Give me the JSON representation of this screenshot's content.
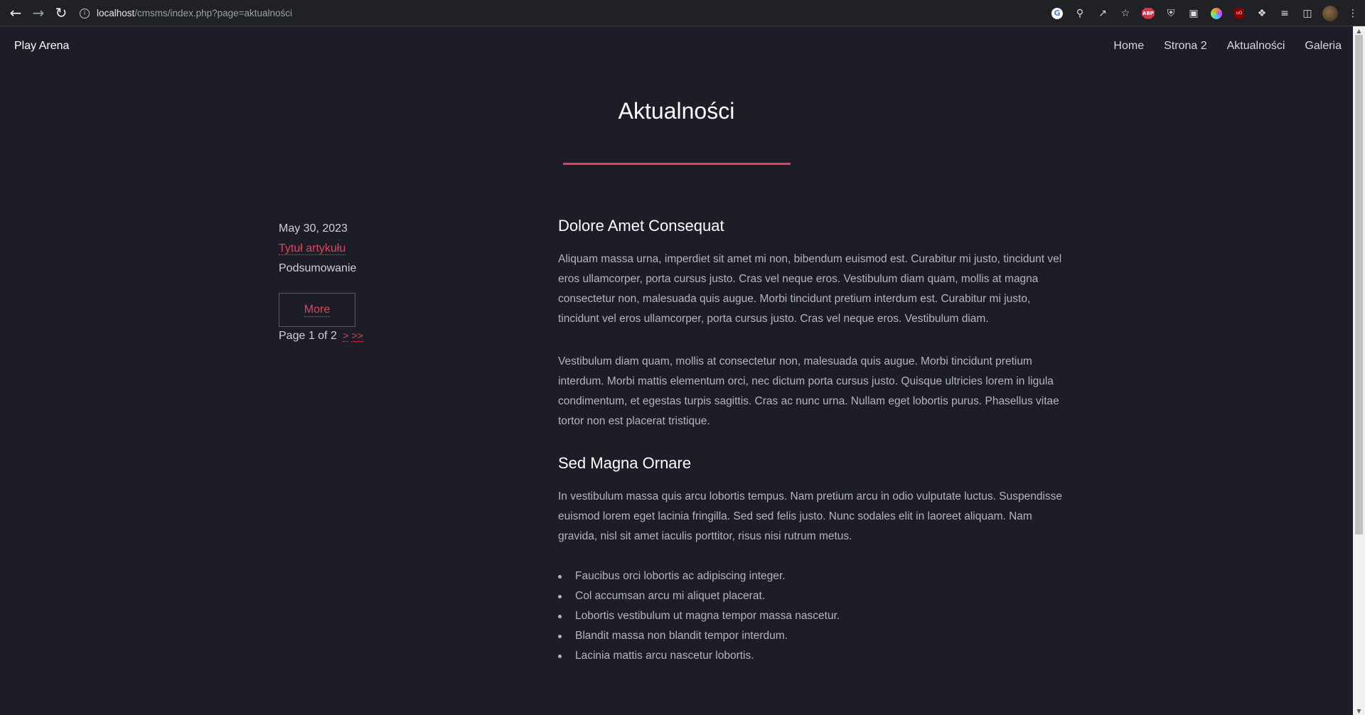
{
  "browser": {
    "url_host": "localhost",
    "url_path": "/cmsms/index.php?page=aktualności",
    "ext_abp": "ABP",
    "ext_ub": "uO"
  },
  "site": {
    "logo": "Play Arena",
    "nav": [
      "Home",
      "Strona 2",
      "Aktualności",
      "Galeria"
    ]
  },
  "page": {
    "title": "Aktualności"
  },
  "sidebar": {
    "date": "May 30, 2023",
    "article_link": "Tytuł artykułu",
    "summary": "Podsumowanie",
    "more_label": "More",
    "pager_text": "Page 1 of 2",
    "pager_next": ">",
    "pager_last": ">>"
  },
  "article": {
    "heading1": "Dolore Amet Consequat",
    "para1": "Aliquam massa urna, imperdiet sit amet mi non, bibendum euismod est. Curabitur mi justo, tincidunt vel eros ullamcorper, porta cursus justo. Cras vel neque eros. Vestibulum diam quam, mollis at magna consectetur non, malesuada quis augue. Morbi tincidunt pretium interdum est. Curabitur mi justo, tincidunt vel eros ullamcorper, porta cursus justo. Cras vel neque eros. Vestibulum diam.",
    "para2": "Vestibulum diam quam, mollis at consectetur non, malesuada quis augue. Morbi tincidunt pretium interdum. Morbi mattis elementum orci, nec dictum porta cursus justo. Quisque ultricies lorem in ligula condimentum, et egestas turpis sagittis. Cras ac nunc urna. Nullam eget lobortis purus. Phasellus vitae tortor non est placerat tristique.",
    "heading2": "Sed Magna Ornare",
    "para3": "In vestibulum massa quis arcu lobortis tempus. Nam pretium arcu in odio vulputate luctus. Suspendisse euismod lorem eget lacinia fringilla. Sed sed felis justo. Nunc sodales elit in laoreet aliquam. Nam gravida, nisl sit amet iaculis porttitor, risus nisi rutrum metus.",
    "list": [
      "Faucibus orci lobortis ac adipiscing integer.",
      "Col accumsan arcu mi aliquet placerat.",
      "Lobortis vestibulum ut magna tempor massa nascetur.",
      "Blandit massa non blandit tempor interdum.",
      "Lacinia mattis arcu nascetur lobortis."
    ]
  },
  "colors": {
    "background": "#1c1d26",
    "accent": "#e0445a"
  }
}
